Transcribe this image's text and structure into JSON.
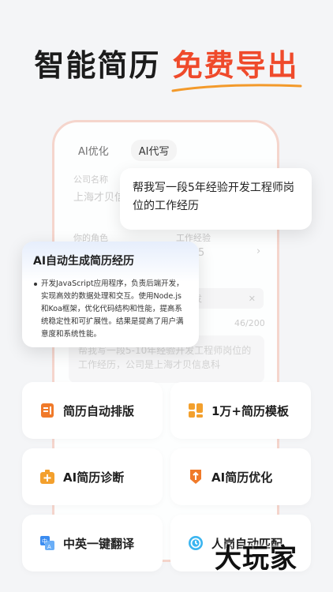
{
  "hero": {
    "line_dark": "智能简历",
    "line_accent": "免费导出"
  },
  "editor": {
    "tabs": [
      {
        "label": "AI优化"
      },
      {
        "label": "AI代写"
      }
    ],
    "company_label": "公司名称",
    "company_value": "上海才贝信息",
    "role_label": "你的角色",
    "experience_label": "工作经验",
    "experience_value": "5",
    "chip_label": "开发",
    "counter": "46/200",
    "prompt_text": "帮我写一段5-10年经验开发工程师岗位的工作经历，公司是上海才贝信息科"
  },
  "bubble": {
    "text": "帮我写一段5年经验开发工程师岗位的工作经历"
  },
  "result": {
    "title": "AI自动生成简历经历",
    "body": "开发JavaScript应用程序，负责后端开发，实现高效的数据处理和交互。使用Node.js和Koa框架，优化代码结构和性能，提高系统稳定性和可扩展性。结果是提高了用户满意度和系统性能。"
  },
  "features": [
    {
      "label": "简历自动排版",
      "icon": "layout-doc-icon"
    },
    {
      "label": "1万+简历模板",
      "icon": "template-grid-icon"
    },
    {
      "label": "AI简历诊断",
      "icon": "diagnosis-kit-icon"
    },
    {
      "label": "AI简历优化",
      "icon": "optimize-badge-icon"
    },
    {
      "label": "中英一键翻译",
      "icon": "translate-icon"
    },
    {
      "label": "人岗自动匹配",
      "icon": "match-clock-icon"
    }
  ],
  "watermark": "大玩家",
  "colors": {
    "accent": "#ef4a2b",
    "orange": "#f39a2b",
    "blue": "#3b8cf0"
  }
}
